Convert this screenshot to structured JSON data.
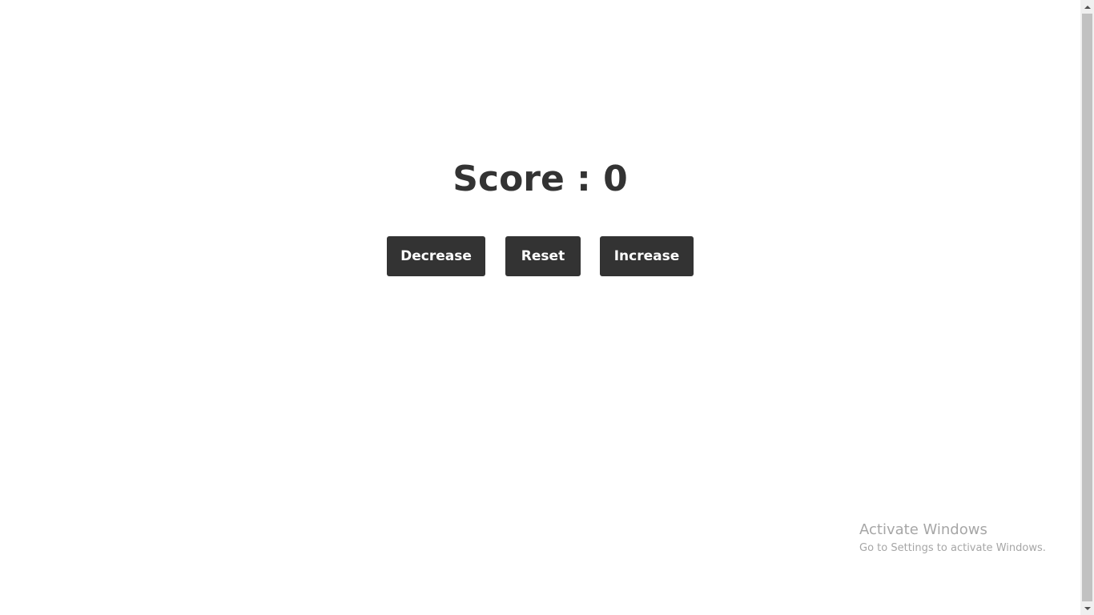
{
  "score": {
    "text": "Score : 0"
  },
  "controls": {
    "decrease_label": "Decrease",
    "reset_label": "Reset",
    "increase_label": "Increase"
  },
  "watermark": {
    "title": "Activate Windows",
    "subtitle": "Go to Settings to activate Windows."
  },
  "colors": {
    "background": "#ffffff",
    "text": "#333333",
    "button_bg": "#333333",
    "button_text": "#ffffff",
    "watermark": "#a6a6a6"
  },
  "icons": {
    "scroll_up": "triangle-up-icon",
    "scroll_down": "triangle-down-icon"
  }
}
